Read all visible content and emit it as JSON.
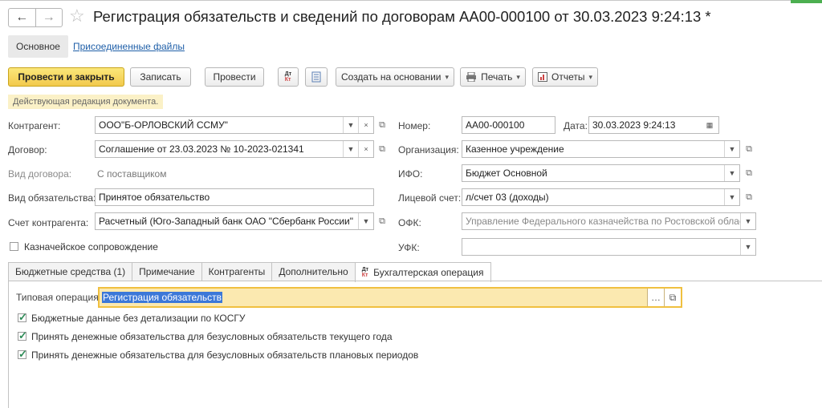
{
  "header": {
    "back_glyph": "←",
    "forward_glyph": "→",
    "star_glyph": "☆",
    "title": "Регистрация обязательств и сведений по договорам АА00-000100 от 30.03.2023 9:24:13 *"
  },
  "subtabs": {
    "main": "Основное",
    "files": "Присоединенные файлы"
  },
  "toolbar": {
    "post_close": "Провести и закрыть",
    "save": "Записать",
    "post": "Провести",
    "dt_label": "Дт",
    "kt_label": "Кт",
    "create_basis": "Создать на основании",
    "print": "Печать",
    "reports": "Отчеты"
  },
  "notice": "Действующая редакция документа.",
  "left": {
    "counterparty_label": "Контрагент:",
    "counterparty": "ООО\"Б-ОРЛОВСКИЙ ССМУ\"",
    "contract_label": "Договор:",
    "contract": "Соглашение от 23.03.2023 № 10-2023-021341",
    "contract_type_label": "Вид договора:",
    "contract_type": "С поставщиком",
    "obligation_type_label": "Вид обязательства:",
    "obligation_type": "Принятое обязательство",
    "account_label": "Счет контрагента:",
    "account": "Расчетный (Юго-Западный банк ОАО \"Сбербанк России\"",
    "treasury_label": "Казначейское сопровождение"
  },
  "right": {
    "number_label": "Номер:",
    "number": "АА00-000100",
    "date_label": "Дата:",
    "date": "30.03.2023  9:24:13",
    "org_label": "Организация:",
    "org": "Казенное учреждение",
    "ifo_label": "ИФО:",
    "ifo": "Бюджет Основной",
    "personal_label": "Лицевой счет:",
    "personal": "л/счет 03 (доходы)",
    "ofk_label": "ОФК:",
    "ofk": "Управление Федерального казначейства по Ростовской област",
    "ufk_label": "УФК:",
    "ufk": ""
  },
  "tabs": [
    "Бюджетные средства (1)",
    "Примечание",
    "Контрагенты",
    "Дополнительно",
    "Бухгалтерская операция"
  ],
  "operation": {
    "typical_label": "Типовая операция:",
    "typical_value": "Регистрация обязательств",
    "check1": "Бюджетные данные без детализации по КОСГУ",
    "check2": "Принять денежные обязательства для безусловных обязательств текущего года",
    "check3": "Принять денежные обязательства для безусловных обязательств плановых периодов"
  }
}
